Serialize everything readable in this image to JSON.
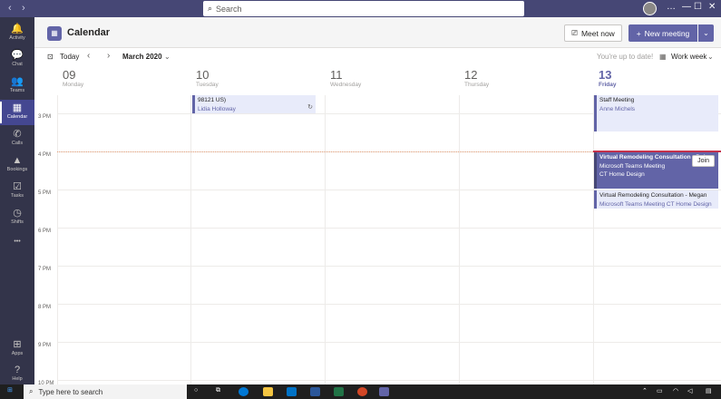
{
  "topbar": {
    "search_placeholder": "Search",
    "nav_back": "‹",
    "nav_forward": "›",
    "more": "…",
    "minimize": "—",
    "maximize": "☐",
    "close": "✕"
  },
  "rail": [
    {
      "label": "Activity",
      "icon": "bell-icon",
      "glyph": "🔔"
    },
    {
      "label": "Chat",
      "icon": "chat-icon",
      "glyph": "💬"
    },
    {
      "label": "Teams",
      "icon": "teams-icon",
      "glyph": "👥"
    },
    {
      "label": "Calendar",
      "icon": "calendar-icon",
      "glyph": "▦"
    },
    {
      "label": "Calls",
      "icon": "phone-icon",
      "glyph": "✆"
    },
    {
      "label": "Bookings",
      "icon": "bookings-icon",
      "glyph": "▲"
    },
    {
      "label": "Tasks",
      "icon": "tasks-icon",
      "glyph": "☑"
    },
    {
      "label": "Shifts",
      "icon": "clock-icon",
      "glyph": "◷"
    },
    {
      "label": "",
      "icon": "more-apps-icon",
      "glyph": "•••"
    },
    {
      "label": "Apps",
      "icon": "apps-icon",
      "glyph": "⊞"
    },
    {
      "label": "Help",
      "icon": "help-icon",
      "glyph": "?"
    }
  ],
  "header": {
    "title": "Calendar",
    "meet_now": "Meet now",
    "new_meeting": "New meeting"
  },
  "toolbar": {
    "today": "Today",
    "month": "March 2020",
    "status": "You're up to date!",
    "view": "Work week"
  },
  "days": [
    {
      "num": "09",
      "name": "Monday"
    },
    {
      "num": "10",
      "name": "Tuesday"
    },
    {
      "num": "11",
      "name": "Wednesday"
    },
    {
      "num": "12",
      "name": "Thursday"
    },
    {
      "num": "13",
      "name": "Friday"
    }
  ],
  "times": [
    "3 PM",
    "4 PM",
    "5 PM",
    "6 PM",
    "7 PM",
    "8 PM",
    "9 PM",
    "10 PM"
  ],
  "events": {
    "tue": {
      "title": "98121 US)",
      "organizer": "Lidia Holloway"
    },
    "staff": {
      "title": "Staff Meeting",
      "organizer": "Anne Michels"
    },
    "debra": {
      "title": "Virtual Remodeling Consultation - Debra",
      "line2": "Microsoft Teams Meeting",
      "line3": "CT Home Design",
      "join": "Join"
    },
    "megan": {
      "title": "Virtual Remodeling Consultation - Megan",
      "line2": "Microsoft Teams Meeting  CT Home Design"
    }
  },
  "taskbar": {
    "search": "Type here to search"
  },
  "colors": {
    "accent": "#6264a7",
    "rail": "#33344a",
    "topbar": "#464775"
  }
}
